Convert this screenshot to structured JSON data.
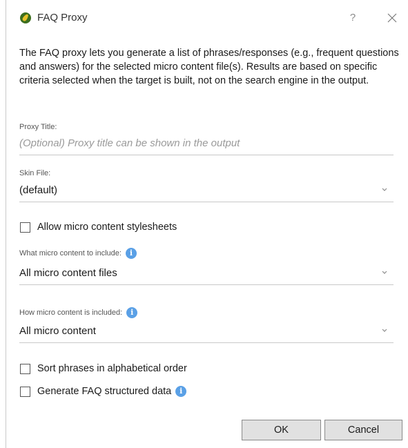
{
  "dialog": {
    "title": "FAQ Proxy",
    "help_glyph": "?",
    "intro": "The FAQ proxy lets you generate a list of phrases/responses (e.g., frequent questions and answers) for the selected micro content file(s). Results are based on specific criteria selected when the target is built, not on the search engine in the output."
  },
  "fields": {
    "proxy_title": {
      "label": "Proxy Title:",
      "value": "",
      "placeholder": "(Optional) Proxy title can be shown in the output"
    },
    "skin_file": {
      "label": "Skin File:",
      "value": "(default)"
    },
    "allow_stylesheets": {
      "label": "Allow micro content stylesheets",
      "checked": false
    },
    "content_include": {
      "label": "What micro content to include:",
      "value": "All micro content files"
    },
    "how_included": {
      "label": "How micro content is included:",
      "value": "All micro content"
    },
    "sort_phrases": {
      "label": "Sort phrases in alphabetical order",
      "checked": false
    },
    "generate_faq": {
      "label": "Generate FAQ structured data",
      "checked": false
    }
  },
  "buttons": {
    "ok": "OK",
    "cancel": "Cancel"
  },
  "icons": {
    "app": "flare-leaf-icon",
    "info": "info-icon",
    "info_glyph": "i"
  },
  "colors": {
    "info_blue": "#5aa0e6",
    "button_bg": "#e1e1e1",
    "underline": "#c8c8c8",
    "placeholder": "#9a9a9a"
  }
}
